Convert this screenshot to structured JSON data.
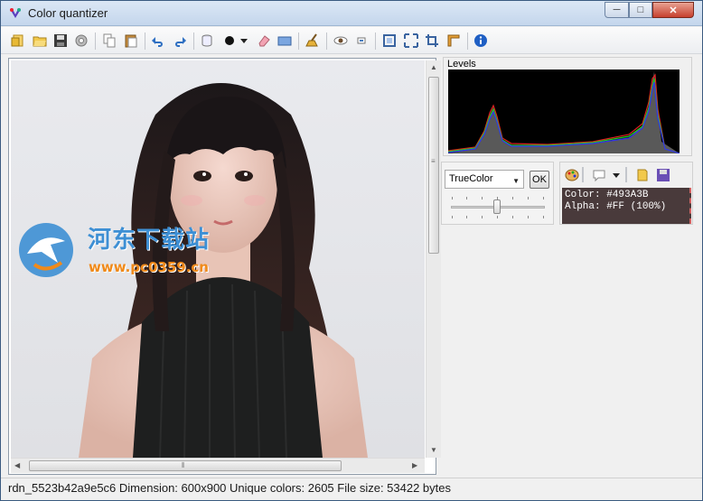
{
  "window": {
    "title": "Color quantizer",
    "controls": {
      "minimize": "─",
      "maximize": "□",
      "close": "✕"
    }
  },
  "toolbar": {
    "icons": [
      "open-file-icon",
      "open-folder-icon",
      "save-icon",
      "settings-gear-icon",
      "copy-icon",
      "paste-icon",
      "undo-icon",
      "redo-icon",
      "cylinder-icon",
      "brush-color-icon",
      "dropdown-icon",
      "eraser-icon",
      "rectangle-icon",
      "broom-icon",
      "eye-icon",
      "small-rect-icon",
      "fit-window-icon",
      "actual-size-icon",
      "crop-icon",
      "ruler-icon",
      "info-icon"
    ]
  },
  "levels": {
    "label": "Levels"
  },
  "quantizer": {
    "mode": "TrueColor",
    "ok_label": "OK",
    "slider_value": 0.5
  },
  "color_panel": {
    "color_line": "Color: #493A3B",
    "alpha_line": "Alpha: #FF (100%)",
    "swatch": "#493A3B"
  },
  "status": {
    "text": "rdn_5523b42a9e5c6 Dimension: 600x900 Unique colors: 2605 File size: 53422 bytes"
  },
  "watermark": {
    "title": "河东下载站",
    "url": "www.pc0359.cn"
  },
  "colors": {
    "accent": "#3d8fd4",
    "close_red": "#c7402e"
  }
}
